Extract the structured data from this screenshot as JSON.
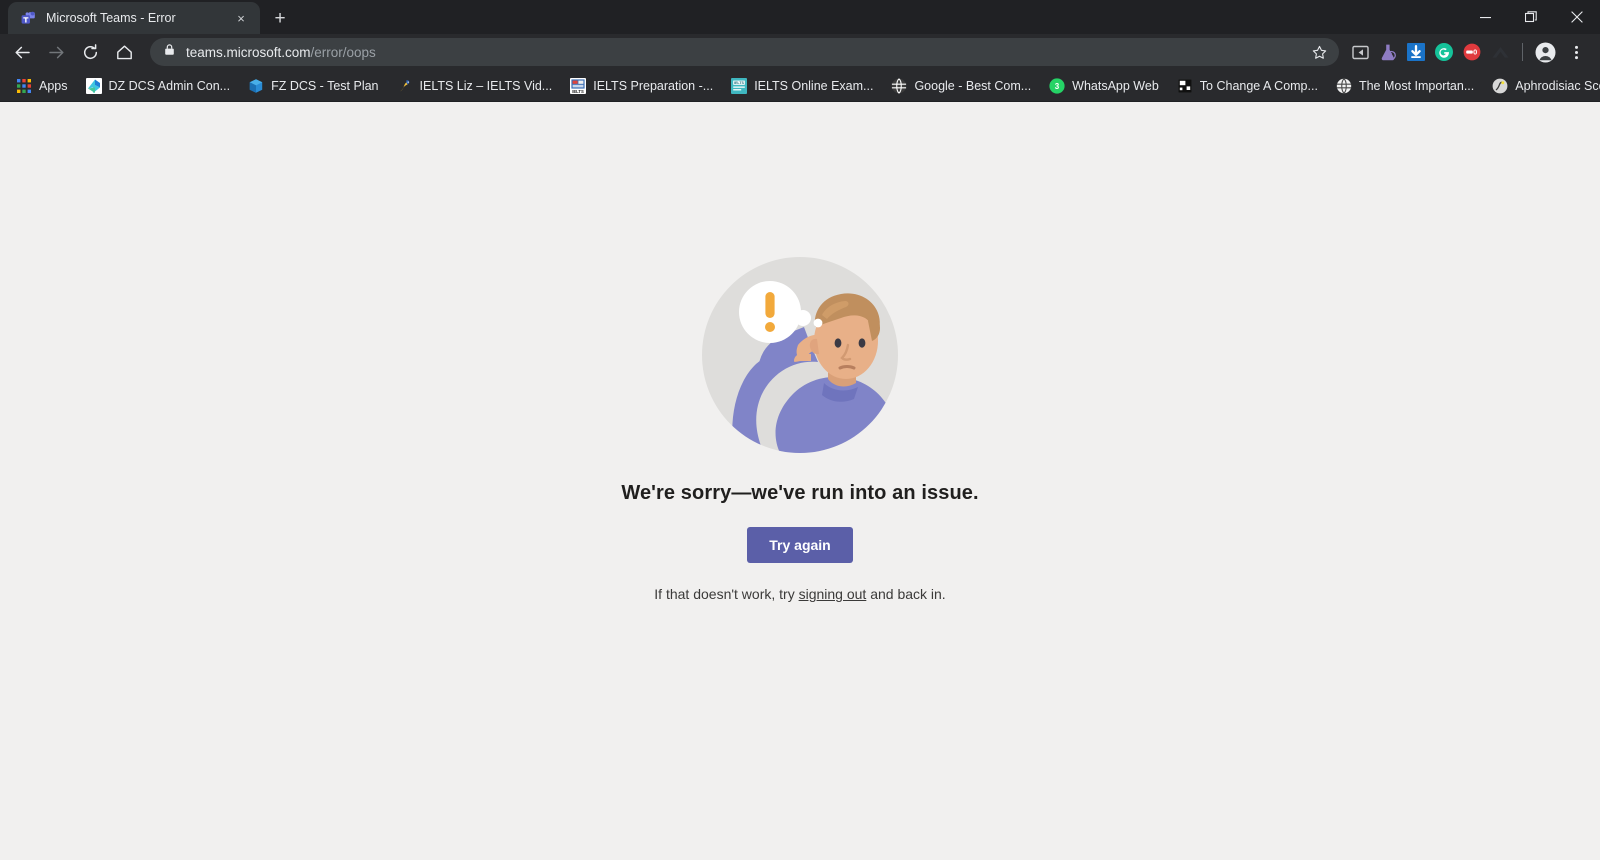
{
  "window": {
    "minimize_label": "Minimize",
    "restore_label": "Restore",
    "close_label": "Close"
  },
  "tabs": [
    {
      "title": "Microsoft Teams - Error",
      "favicon": "teams-icon",
      "close_label": "×"
    }
  ],
  "new_tab_label": "+",
  "toolbar": {
    "back_label": "Back",
    "forward_label": "Forward",
    "reload_label": "Reload",
    "home_label": "Home",
    "url_domain": "teams.microsoft.com",
    "url_path": "/error/oops",
    "lock_icon": "lock-icon",
    "star_icon": "bookmark-star-icon",
    "extensions": [
      {
        "name": "media-cast-extension-icon",
        "color": "#c7c9cc"
      },
      {
        "name": "lab-flask-extension-icon",
        "color": "#8e7cc3"
      },
      {
        "name": "download-manager-extension-icon",
        "color": "#1a73c8"
      },
      {
        "name": "grammarly-extension-icon",
        "color": "#15c39a",
        "label": "G"
      },
      {
        "name": "adblock-extension-icon",
        "color": "#e03a3e",
        "label": "0"
      },
      {
        "name": "nord-vpn-extension-icon",
        "color": "#2c2f33"
      }
    ],
    "profile_icon": "profile-avatar-icon",
    "menu_icon": "three-dot-menu-icon"
  },
  "bookmarks": {
    "items": [
      {
        "label": "Apps",
        "icon": "apps-grid-icon"
      },
      {
        "label": "DZ DCS Admin Con...",
        "icon": "azure-devops-icon"
      },
      {
        "label": "FZ DCS - Test Plan",
        "icon": "azure-testplan-icon"
      },
      {
        "label": "IELTS Liz – IELTS Vid...",
        "icon": "ielts-liz-icon"
      },
      {
        "label": "IELTS Preparation -...",
        "icon": "ielts-prep-icon"
      },
      {
        "label": "IELTS Online Exam...",
        "icon": "ielts-online-icon"
      },
      {
        "label": "Google - Best Com...",
        "icon": "globe-icon"
      },
      {
        "label": "WhatsApp Web",
        "icon": "whatsapp-icon",
        "badge": "3"
      },
      {
        "label": "To Change A Comp...",
        "icon": "generic-page-icon"
      },
      {
        "label": "The Most Importan...",
        "icon": "globe-icon"
      },
      {
        "label": "Aphrodisiac Scents",
        "icon": "scent-icon"
      }
    ],
    "overflow_label": "»"
  },
  "page": {
    "illustration": {
      "name": "person-confused-illustration",
      "circle_color": "#dedddb",
      "shirt_color": "#8084c8",
      "skin_color": "#e8b088",
      "hair_color": "#c08f5e",
      "bubble_color": "#ffffff",
      "exclamation_color": "#f2a93b"
    },
    "headline": "We're sorry—we've run into an issue.",
    "try_again_label": "Try again",
    "try_again_color": "#5b5fa8",
    "subline_prefix": "If that doesn't work, try ",
    "subline_link": "signing out",
    "subline_suffix": " and back in.",
    "background_color": "#f1f0ef"
  }
}
